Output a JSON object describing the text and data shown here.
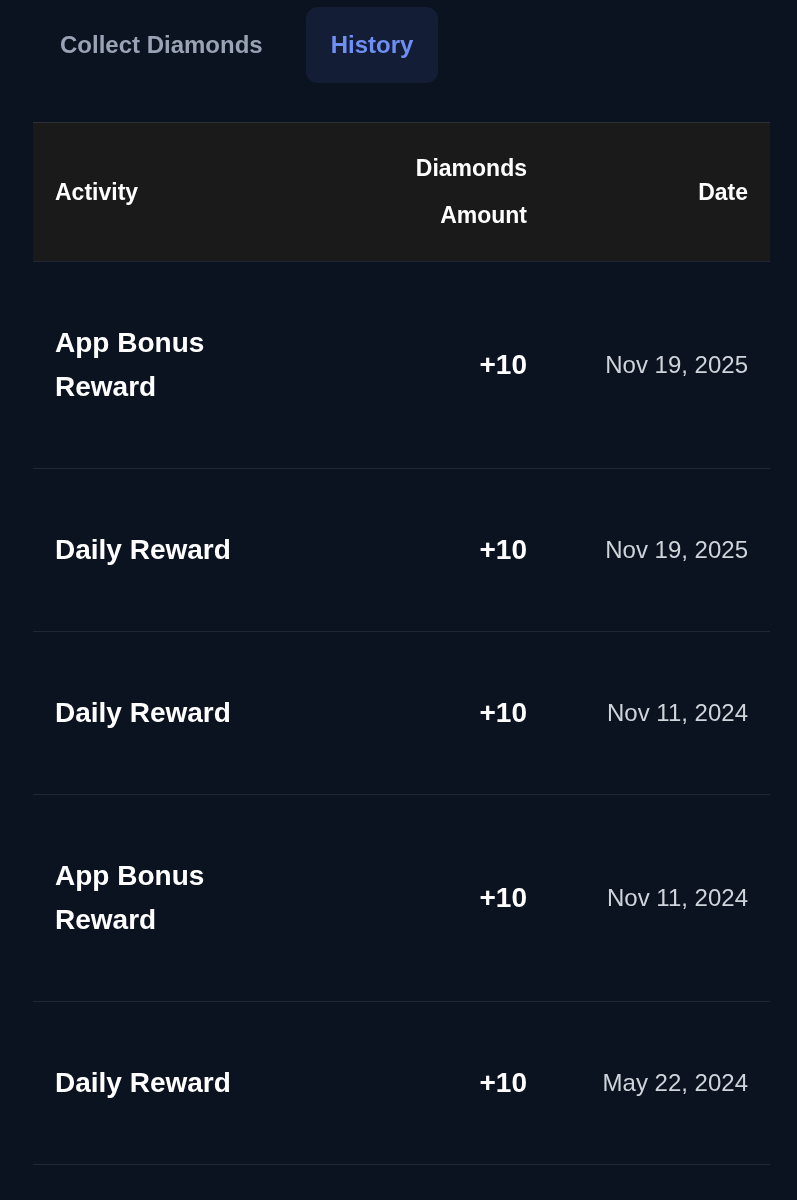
{
  "tabs": [
    {
      "label": "Collect Diamonds",
      "selected": false
    },
    {
      "label": "History",
      "selected": true
    }
  ],
  "table": {
    "columns": [
      "Activity",
      "Diamonds Amount",
      "Date"
    ],
    "rows": [
      [
        "App Bonus Reward",
        "+10",
        "Nov 19, 2025"
      ],
      [
        "Daily Reward",
        "+10",
        "Nov 19, 2025"
      ],
      [
        "Daily Reward",
        "+10",
        "Nov 11, 2024"
      ],
      [
        "App Bonus Reward",
        "+10",
        "Nov 11, 2024"
      ],
      [
        "Daily Reward",
        "+10",
        "May 22, 2024"
      ]
    ]
  }
}
